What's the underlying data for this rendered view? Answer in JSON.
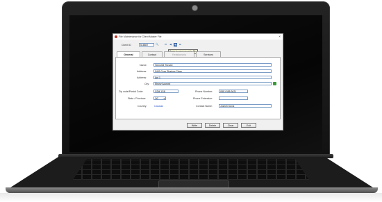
{
  "window": {
    "title": "File Maintenance for Client Master File",
    "close_glyph": "×"
  },
  "client_id": {
    "label": "Client ID",
    "value": "516857"
  },
  "nav": {
    "search": "🔍",
    "first": "⏮",
    "prev": "◀",
    "next": "▶",
    "last": "⏭"
  },
  "tooltip": "Press for next record in File",
  "tabs": [
    "General",
    "Contact",
    "Relationship",
    "Services"
  ],
  "form": {
    "name_label": "Name:",
    "name_value": "Hemphill Theatre",
    "address_label": "Address:",
    "address_value": "9409 Cozy Shadow Close",
    "address2_label": "Address:",
    "address2_value": "Apt 1",
    "city_label": "City:",
    "city_value": "Ebony Acorord",
    "zip_label": "Zip code/Postal Code:",
    "zip_value": "G2M 1G8",
    "phone_label": "Phone Number:",
    "phone_value": "(581) 555-9421",
    "state_label": "State / Province:",
    "state_value": "QC",
    "ext_label": "Phone Extension:",
    "ext_value": "",
    "country_label": "Country:",
    "country_value": "Canada",
    "contact_label": "Contact Name:",
    "contact_value": "Joseph Davis"
  },
  "buttons": {
    "write": "Write",
    "delete": "Delete",
    "clear": "Clear",
    "exit": "Exit"
  },
  "colors": {
    "field_border": "#7a9cc6",
    "link": "#2255cc",
    "screen": "#050505"
  }
}
